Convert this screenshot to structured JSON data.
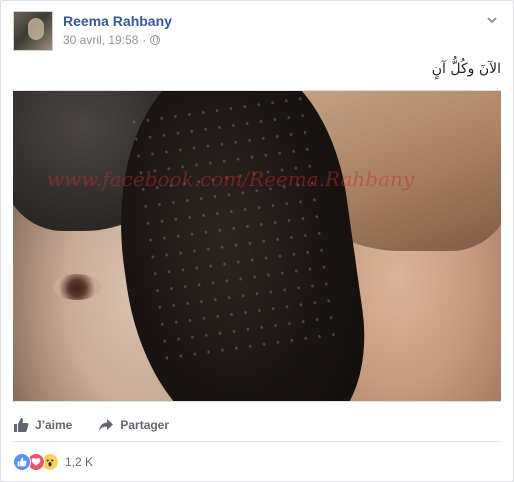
{
  "post": {
    "author": "Reema Rahbany",
    "timestamp": "30 avril, 19:58",
    "separator": "·",
    "privacy_icon": "globe-icon",
    "text": "الآنَ وكُلُّ آنٍ",
    "image_watermark": "www.facebook.com/Reema.Rahbany"
  },
  "actions": {
    "like_label": "J’aime",
    "share_label": "Partager"
  },
  "reactions": {
    "types": [
      "like",
      "love",
      "wow"
    ],
    "count": "1,2 K"
  },
  "colors": {
    "author_link": "#365899",
    "meta": "#90949c",
    "like_blue": "#5890ff",
    "love_red": "#f25268",
    "wow_yellow": "#fcd05a"
  }
}
